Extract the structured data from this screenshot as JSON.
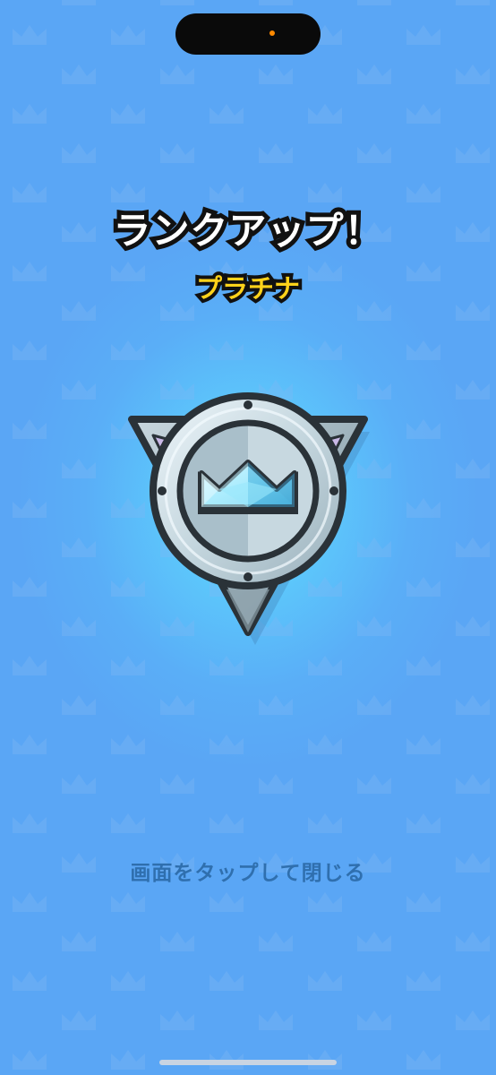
{
  "rank_up": {
    "title": "ランクアップ！",
    "rank_name": "プラチナ",
    "tap_hint": "画面をタップして閉じる"
  },
  "badge": {
    "icon": "crown-icon",
    "tier": "platinum"
  },
  "colors": {
    "background": "#5aa6f5",
    "glow": "#6fdcff",
    "title_text": "#ffffff",
    "rank_text": "#ffd21a",
    "hint_text": "#2f6fae",
    "outline": "#111111"
  }
}
